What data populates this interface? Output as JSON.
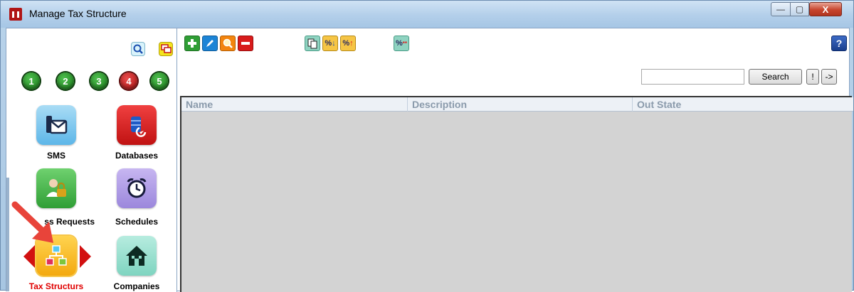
{
  "window": {
    "title": "Manage Tax Structure",
    "minimize": "—",
    "maximize": "▢",
    "close": "X"
  },
  "sidebar": {
    "pages": [
      "1",
      "2",
      "3",
      "4",
      "5"
    ],
    "active_page": "4",
    "tiles": [
      {
        "label": "SMS",
        "icon": "sms-mail-icon"
      },
      {
        "label": "Databases",
        "icon": "database-icon"
      },
      {
        "label": "Access Requests",
        "visible_text": "ss Requests",
        "icon": "access-requests-icon"
      },
      {
        "label": "Schedules",
        "icon": "alarm-clock-icon"
      },
      {
        "label": "Tax Structurs",
        "icon": "tax-structure-icon",
        "selected": true
      },
      {
        "label": "Companies",
        "icon": "house-icon"
      }
    ]
  },
  "toolbar": {
    "help": "?",
    "pct": "%"
  },
  "search": {
    "value": "",
    "button": "Search",
    "exclaim": "!",
    "arrow": "->"
  },
  "grid": {
    "columns": [
      "Name",
      "Description",
      "Out State"
    ]
  },
  "colors": {
    "selected_label": "#e00000",
    "grid_bg": "#d3d3d3"
  }
}
